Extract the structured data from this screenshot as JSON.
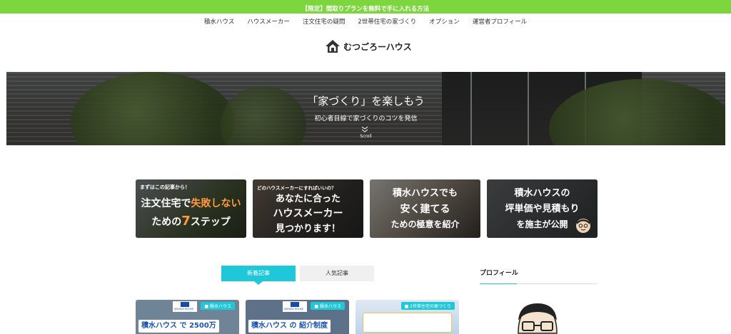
{
  "topbar": {
    "text": "【限定】間取りプランを無料で手に入れる方法",
    "color": "#7ed63f"
  },
  "nav": {
    "items": [
      "積水ハウス",
      "ハウスメーカー",
      "注文住宅の疑問",
      "2世帯住宅の家づくり",
      "オプション",
      "運営者プロフィール"
    ]
  },
  "logo": {
    "text": "むつごろーハウス",
    "icon": "house-icon"
  },
  "hero": {
    "title": "「家づくり」を楽しもう",
    "subtitle": "初心者目線で家づくりのコツを発信",
    "scroll": "Scroll"
  },
  "cards": [
    {
      "small": "まずはこの記事から！",
      "line1a": "注文住宅で",
      "line1b": "失敗しない",
      "line2a": "ための",
      "line2b": "7",
      "line2c": "ステップ"
    },
    {
      "small": "どのハウスメーカーにすればいいの？",
      "line1": "あなたに合った",
      "line2": "ハウスメーカー",
      "line3": "見つかります！"
    },
    {
      "line1": "積水ハウスでも",
      "line2": "安く建てる",
      "line3": "ための極意を紹介"
    },
    {
      "line1": "積水ハウスの",
      "line2": "坪単価や見積もり",
      "line3": "を施主が公開"
    }
  ],
  "tabs": [
    {
      "label": "新着記事",
      "active": true
    },
    {
      "label": "人気記事",
      "active": false
    }
  ],
  "profile": {
    "title": "プロフィール"
  },
  "posts": [
    {
      "category": "積水ハウス",
      "brand": "SEKISUI HOUSE",
      "headline": "積水ハウス で 2500万"
    },
    {
      "category": "積水ハウス",
      "brand": "SEKISUI HOUSE",
      "headline": "積水ハウス の 紹介制度"
    },
    {
      "category": "2世帯住宅の家づくり"
    }
  ],
  "colors": {
    "accent": "#1fc8d8",
    "highlight": "#ff9a3c",
    "post_headline": "#1b53b3"
  }
}
